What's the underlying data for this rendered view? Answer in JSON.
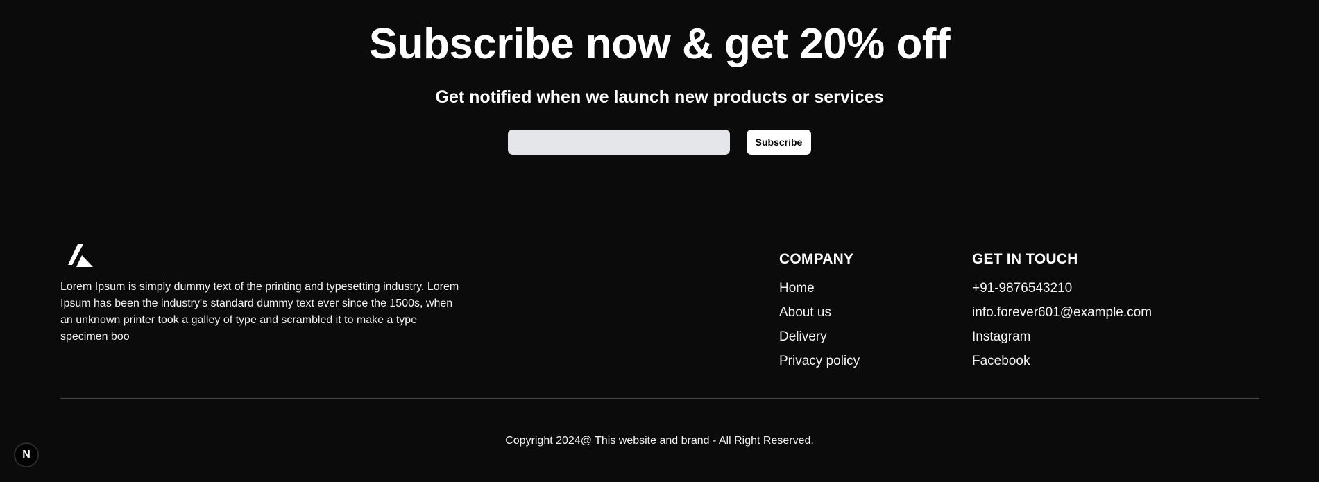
{
  "subscribe": {
    "title": "Subscribe now & get 20% off",
    "subtitle": "Get notified when we launch new products or services",
    "email_placeholder": "",
    "button_label": "Subscribe"
  },
  "footer": {
    "logo_icon": "triangle-logo-icon",
    "about_text": "Lorem Ipsum is simply dummy text of the printing and typesetting industry. Lorem Ipsum has been the industry's standard dummy text ever since the 1500s, when an unknown printer took a galley of type and scrambled it to make a type specimen boo",
    "company": {
      "title": "COMPANY",
      "links": [
        "Home",
        "About us",
        "Delivery",
        "Privacy policy"
      ]
    },
    "contact": {
      "title": "GET IN TOUCH",
      "items": [
        "+91-9876543210",
        "info.forever601@example.com",
        "Instagram",
        "Facebook"
      ]
    },
    "copyright": "Copyright 2024@ This website and brand - All Right Reserved."
  },
  "dev_badge": {
    "label": "N"
  },
  "colors": {
    "background": "#0b0b0b",
    "text": "#ffffff",
    "input_bg": "#e5e6ea",
    "divider": "#4a4a4a"
  }
}
